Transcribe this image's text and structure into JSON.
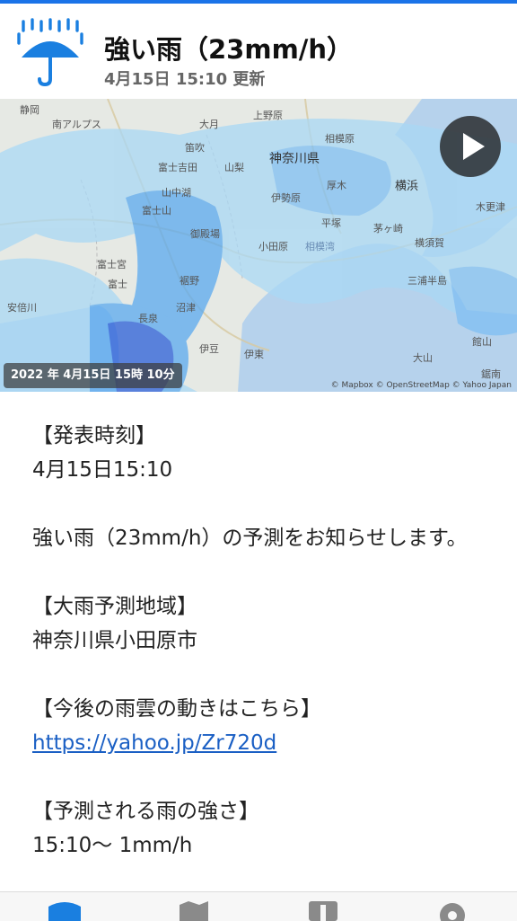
{
  "header": {
    "title": "強い雨（23mm/h）",
    "updated": "4月15日 15:10 更新"
  },
  "map": {
    "timestamp": "2022 年 4月15日 15時 10分",
    "attribution": "© Mapbox © OpenStreetMap © Yahoo Japan",
    "labels": [
      "静岡",
      "南アルプス",
      "大月",
      "上野原",
      "相模原",
      "富士吉田",
      "笛吹",
      "山梨",
      "神奈川県",
      "厚木",
      "横浜",
      "平塚",
      "富士山",
      "山中湖",
      "伊勢原",
      "茅ヶ崎",
      "御殿場",
      "小田原",
      "相模湾",
      "横須賀",
      "富士宮",
      "裾野",
      "三浦半島",
      "富士",
      "沼津",
      "長泉",
      "安倍川",
      "伊豆",
      "伊東",
      "館山",
      "大山",
      "鋸南",
      "木更津"
    ]
  },
  "message": {
    "heading1": "【発表時刻】",
    "time": "4月15日15:10",
    "body": "強い雨（23mm/h）の予測をお知らせします。",
    "heading2": "【大雨予測地域】",
    "region": "神奈川県小田原市",
    "heading3": "【今後の雨雲の動きはこちら】",
    "link": "https://yahoo.jp/Zr720d",
    "heading4": "【予測される雨の強さ】",
    "forecast_line": "15:10～ 1mm/h"
  },
  "colors": {
    "accent": "#1a73e8",
    "rain_light": "#a9d8f5",
    "rain_medium": "#5aa9ef",
    "rain_heavy": "#2b5fd9"
  }
}
